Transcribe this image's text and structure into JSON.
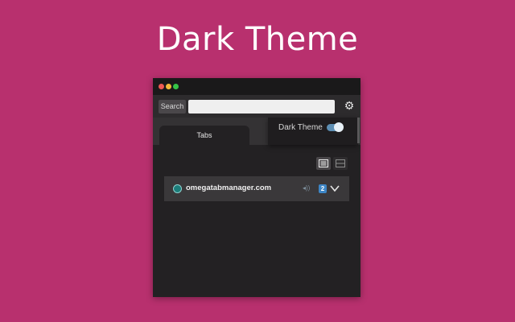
{
  "banner": {
    "title": "Dark Theme"
  },
  "toolbar": {
    "search_label": "Search",
    "search_value": ""
  },
  "tabs": [
    {
      "label": "Tabs",
      "active": true
    }
  ],
  "settings_menu": {
    "dark_theme_label": "Dark Theme",
    "dark_theme_enabled": true
  },
  "tab_list": [
    {
      "domain": "omegatabmanager.com",
      "tab_count": "2"
    }
  ],
  "icons": {
    "settings": "gear-icon",
    "list_view": "list-view-icon",
    "grid_view": "grid-view-icon",
    "audio": "audio-icon",
    "expand": "chevron-down-icon"
  },
  "colors": {
    "background": "#b8306e",
    "window": "#232123",
    "toggle_on": "#5d8fb4",
    "badge": "#3d86c6"
  }
}
